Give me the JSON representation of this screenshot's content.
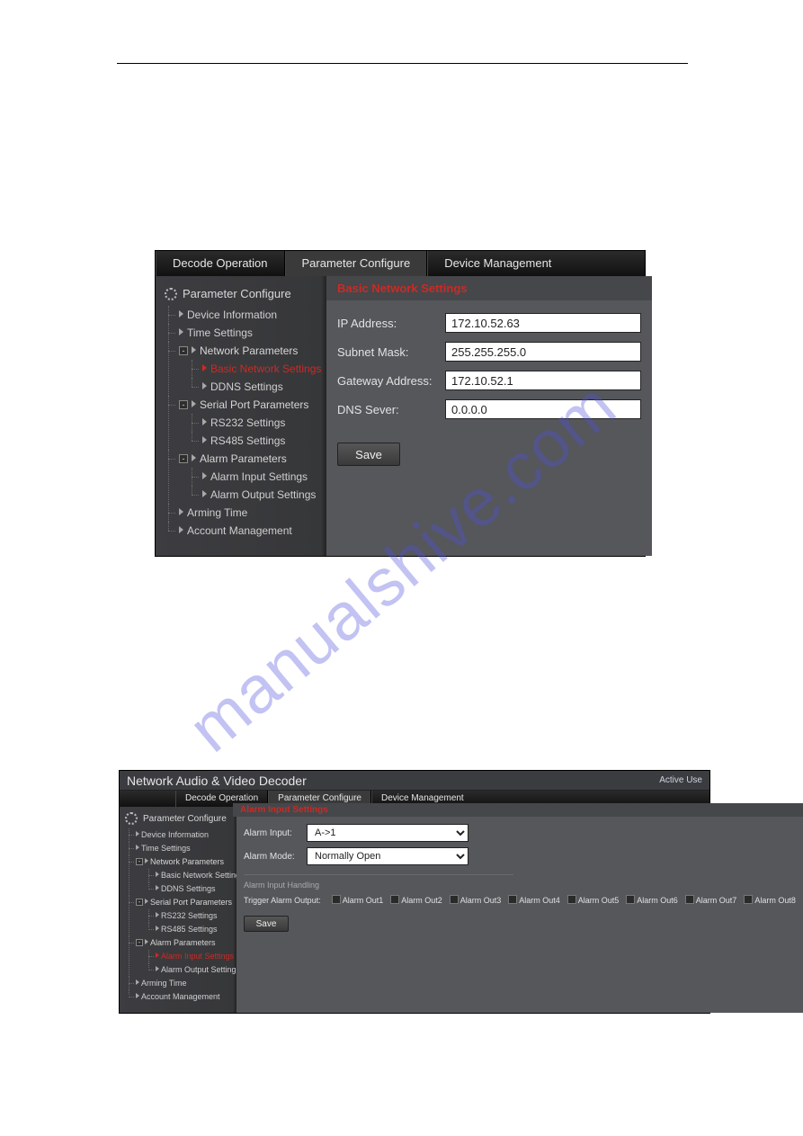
{
  "watermark": "manualshive.com",
  "tabs": {
    "decode": "Decode Operation",
    "param": "Parameter Configure",
    "device": "Device Management"
  },
  "tree": {
    "root": "Parameter Configure",
    "deviceInfo": "Device Information",
    "timeSettings": "Time Settings",
    "networkParams": "Network Parameters",
    "basicNet": "Basic Network Settings",
    "ddns": "DDNS Settings",
    "serialPort": "Serial Port Parameters",
    "rs232": "RS232 Settings",
    "rs485": "RS485 Settings",
    "alarmParams": "Alarm Parameters",
    "alarmIn": "Alarm Input Settings",
    "alarmOut": "Alarm Output Settings",
    "armingTime": "Arming Time",
    "accountMgmt": "Account Management"
  },
  "panel1": {
    "title": "Basic Network Settings",
    "ipLabel": "IP Address:",
    "ipValue": "172.10.52.63",
    "subnetLabel": "Subnet Mask:",
    "subnetValue": "255.255.255.0",
    "gatewayLabel": "Gateway Address:",
    "gatewayValue": "172.10.52.1",
    "dnsLabel": "DNS Sever:",
    "dnsValue": "0.0.0.0",
    "save": "Save"
  },
  "panel2": {
    "appTitle": "Network Audio & Video Decoder",
    "activeUser": "Active Use",
    "title": "Alarm Input Settings",
    "alarmInputLabel": "Alarm Input:",
    "alarmInputValue": "A->1",
    "alarmModeLabel": "Alarm Mode:",
    "alarmModeValue": "Normally Open",
    "handlingTitle": "Alarm Input Handling",
    "triggerLabel": "Trigger Alarm Output:",
    "outs": [
      "Alarm Out1",
      "Alarm Out2",
      "Alarm Out3",
      "Alarm Out4",
      "Alarm Out5",
      "Alarm Out6",
      "Alarm Out7",
      "Alarm Out8"
    ],
    "save": "Save"
  }
}
